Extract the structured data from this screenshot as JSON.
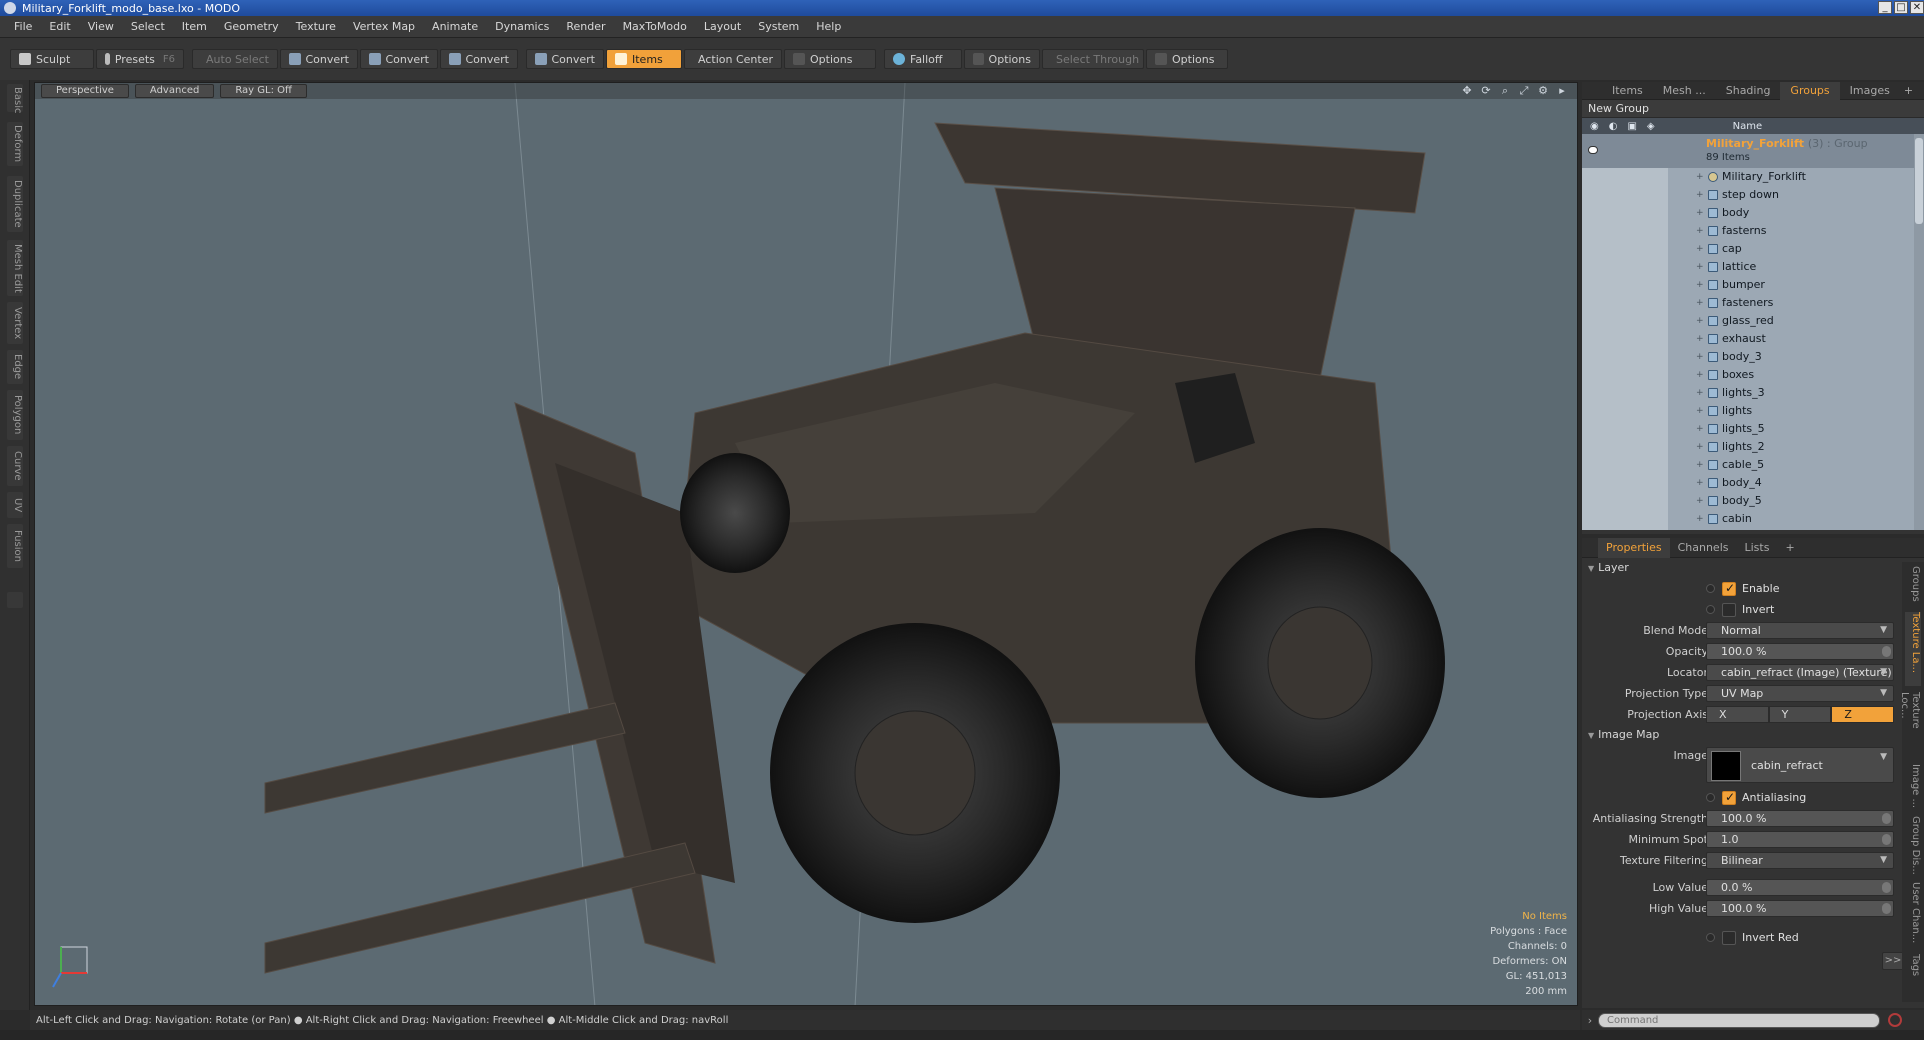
{
  "window": {
    "title": "Military_Forklift_modo_base.lxo - MODO",
    "controls": [
      "_",
      "□",
      "✕"
    ]
  },
  "menu": [
    "File",
    "Edit",
    "View",
    "Select",
    "Item",
    "Geometry",
    "Texture",
    "Vertex Map",
    "Animate",
    "Dynamics",
    "Render",
    "MaxToModo",
    "Layout",
    "System",
    "Help"
  ],
  "toolbar": {
    "sculpt": "Sculpt",
    "presets": "Presets",
    "presets_key": "F6",
    "auto_select": "Auto Select",
    "convert": "Convert",
    "items": "Items",
    "action_center": "Action Center",
    "options": "Options",
    "falloff": "Falloff",
    "select_through": "Select Through"
  },
  "left_tabs": [
    "Basic",
    "Deform",
    "Duplicate",
    "Mesh Edit",
    "Vertex",
    "Edge",
    "Polygon",
    "Curve",
    "UV",
    "Fusion"
  ],
  "viewport": {
    "view": "Perspective",
    "shading": "Advanced",
    "raygl": "Ray GL: Off",
    "stats": {
      "no_items": "No Items",
      "polygons": "Polygons : Face",
      "channels": "Channels: 0",
      "deformers": "Deformers: ON",
      "gl": "GL: 451,013",
      "scale": "200 mm"
    }
  },
  "status": "Alt-Left Click and Drag: Navigation: Rotate (or Pan) ● Alt-Right Click and Drag: Navigation: Freewheel ● Alt-Middle Click and Drag: navRoll",
  "groups_panel": {
    "tabs": [
      "Items",
      "Mesh ...",
      "Shading",
      "Groups",
      "Images"
    ],
    "active_tab": "Groups",
    "new_group": "New Group",
    "col_name": "Name",
    "group_name": "Military_Forklift",
    "group_tag": "(3) : Group",
    "group_count": "89 Items",
    "items": [
      "Military_Forklift",
      "step down",
      "body",
      "fasterns",
      "cap",
      "lattice",
      "bumper",
      "fasteners",
      "glass_red",
      "exhaust",
      "body_3",
      "boxes",
      "lights_3",
      "lights",
      "lights_5",
      "lights_2",
      "cable_5",
      "body_4",
      "body_5",
      "cabin"
    ]
  },
  "properties": {
    "tabs": [
      "Properties",
      "Channels",
      "Lists"
    ],
    "layer_section": "Layer",
    "enable": "Enable",
    "invert": "Invert",
    "blend_mode_label": "Blend Mode",
    "blend_mode": "Normal",
    "opacity_label": "Opacity",
    "opacity": "100.0 %",
    "locator_label": "Locator",
    "locator": "cabin_refract (Image) (Texture)",
    "projection_type_label": "Projection Type",
    "projection_type": "UV Map",
    "projection_axis_label": "Projection Axis",
    "axis": [
      "X",
      "Y",
      "Z"
    ],
    "image_map_section": "Image Map",
    "image_label": "Image",
    "image": "cabin_refract",
    "antialiasing": "Antialiasing",
    "aa_strength_label": "Antialiasing Strength",
    "aa_strength": "100.0 %",
    "min_spot_label": "Minimum Spot",
    "min_spot": "1.0",
    "tex_filter_label": "Texture Filtering",
    "tex_filter": "Bilinear",
    "low_label": "Low Value",
    "low": "0.0 %",
    "high_label": "High Value",
    "high": "100.0 %",
    "invert_red": "Invert Red",
    "more": ">>"
  },
  "side_tabs": [
    "Groups",
    "Texture La...",
    "Texture Loc...",
    "Image ...",
    "Group Dis...",
    "User Chan...",
    "Tags"
  ],
  "command": {
    "placeholder": "Command"
  },
  "colors": {
    "accent": "#f2a23a",
    "viewport_bg": "#5c6a72"
  }
}
